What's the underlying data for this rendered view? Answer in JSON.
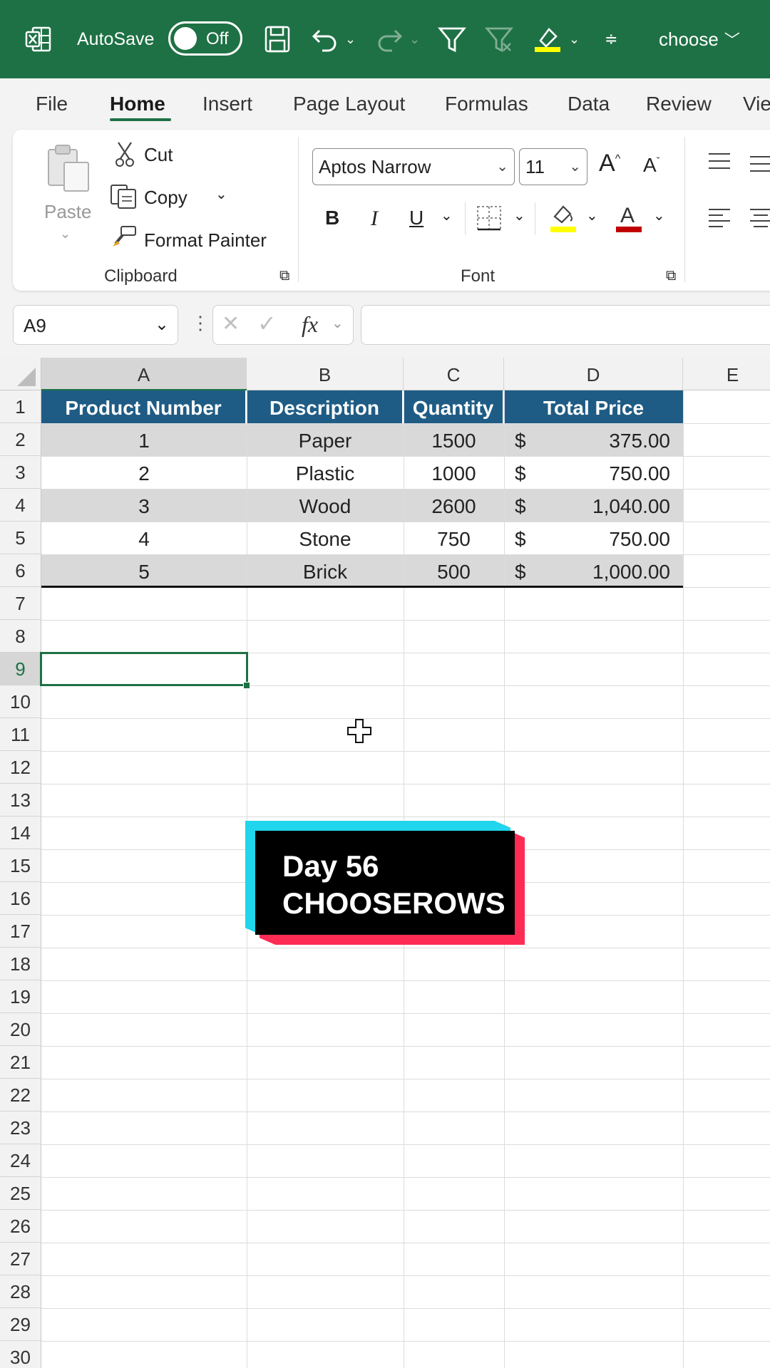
{
  "titlebar": {
    "autosave_label": "AutoSave",
    "autosave_state": "Off",
    "file_name": "choose",
    "accent": "#1e7145"
  },
  "tabs": [
    "File",
    "Home",
    "Insert",
    "Page Layout",
    "Formulas",
    "Data",
    "Review",
    "Vie"
  ],
  "active_tab": "Home",
  "clipboard": {
    "paste": "Paste",
    "cut": "Cut",
    "copy": "Copy",
    "format_painter": "Format Painter",
    "group_label": "Clipboard"
  },
  "font": {
    "family": "Aptos Narrow",
    "size": "11",
    "bold": "B",
    "italic": "I",
    "underline": "U",
    "group_label": "Font",
    "highlight_color": "#ffff00",
    "font_color": "#c00000"
  },
  "formula_bar": {
    "name_box": "A9",
    "fx": "fx",
    "formula": ""
  },
  "sheet": {
    "columns": [
      "A",
      "B",
      "C",
      "D",
      "E"
    ],
    "selected_column": "A",
    "selected_row": "9",
    "active_cell": "A9",
    "header_color": "#1f5c85",
    "band_color": "#d9d9d9",
    "headers": [
      "Product Number",
      "Description",
      "Quantity",
      "Total Price"
    ],
    "rows": [
      {
        "num": "1",
        "desc": "Paper",
        "qty": "1500",
        "cur": "$",
        "price": "375.00"
      },
      {
        "num": "2",
        "desc": "Plastic",
        "qty": "1000",
        "cur": "$",
        "price": "750.00"
      },
      {
        "num": "3",
        "desc": "Wood",
        "qty": "2600",
        "cur": "$",
        "price": "1,040.00"
      },
      {
        "num": "4",
        "desc": "Stone",
        "qty": "750",
        "cur": "$",
        "price": "750.00"
      },
      {
        "num": "5",
        "desc": "Brick",
        "qty": "500",
        "cur": "$",
        "price": "1,000.00"
      }
    ],
    "row_numbers": [
      "1",
      "2",
      "3",
      "4",
      "5",
      "6",
      "7",
      "8",
      "9",
      "10",
      "11",
      "12",
      "13",
      "14",
      "15",
      "16",
      "17",
      "18",
      "19",
      "20",
      "21",
      "22",
      "23",
      "24",
      "25",
      "26",
      "27",
      "28",
      "29",
      "30"
    ]
  },
  "overlay": {
    "line1": "Day 56",
    "line2": "CHOOSEROWS"
  }
}
